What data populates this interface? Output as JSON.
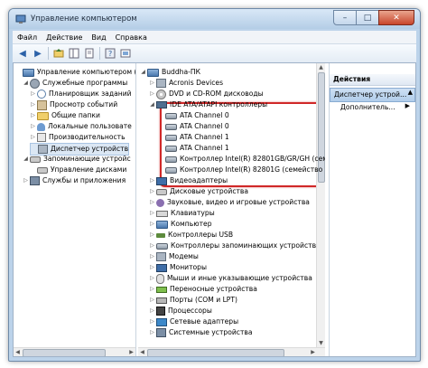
{
  "window": {
    "title": "Управление компьютером",
    "controls": {
      "minimize": "–",
      "maximize": "□",
      "close": "✕"
    }
  },
  "menu": [
    "Файл",
    "Действие",
    "Вид",
    "Справка"
  ],
  "toolbar": [
    "back-icon",
    "forward-icon",
    "up-icon",
    "show-tree-icon",
    "properties-icon",
    "help-icon",
    "view-icon"
  ],
  "left_tree": [
    {
      "label": "Управление компьютером (л",
      "level": 0,
      "expander": "",
      "icon": "pc"
    },
    {
      "label": "Служебные программы",
      "level": 1,
      "expander": "◢",
      "icon": "tool"
    },
    {
      "label": "Планировщик заданий",
      "level": 2,
      "expander": "▷",
      "icon": "clock"
    },
    {
      "label": "Просмотр событий",
      "level": 2,
      "expander": "▷",
      "icon": "log"
    },
    {
      "label": "Общие папки",
      "level": 2,
      "expander": "▷",
      "icon": "folder"
    },
    {
      "label": "Локальные пользовате",
      "level": 2,
      "expander": "▷",
      "icon": "users"
    },
    {
      "label": "Производительность",
      "level": 2,
      "expander": "▷",
      "icon": "perf"
    },
    {
      "label": "Диспетчер устройств",
      "level": 2,
      "expander": "",
      "icon": "dev",
      "selected": true
    },
    {
      "label": "Запоминающие устройс",
      "level": 1,
      "expander": "◢",
      "icon": "disk"
    },
    {
      "label": "Управление дисками",
      "level": 2,
      "expander": "",
      "icon": "disk"
    },
    {
      "label": "Службы и приложения",
      "level": 1,
      "expander": "▷",
      "icon": "sys"
    }
  ],
  "device_tree": [
    {
      "label": "Buddha-ПК",
      "level": 0,
      "expander": "◢",
      "icon": "pc"
    },
    {
      "label": "Acronis Devices",
      "level": 1,
      "expander": "▷",
      "icon": "dev"
    },
    {
      "label": "DVD и CD-ROM дисководы",
      "level": 1,
      "expander": "▷",
      "icon": "dvd"
    },
    {
      "label": "IDE ATA/ATAPI контроллеры",
      "level": 1,
      "expander": "◢",
      "icon": "chip"
    },
    {
      "label": "ATA Channel 0",
      "level": 2,
      "expander": "",
      "icon": "ctrl"
    },
    {
      "label": "ATA Channel 0",
      "level": 2,
      "expander": "",
      "icon": "ctrl"
    },
    {
      "label": "ATA Channel 1",
      "level": 2,
      "expander": "",
      "icon": "ctrl"
    },
    {
      "label": "ATA Channel 1",
      "level": 2,
      "expander": "",
      "icon": "ctrl"
    },
    {
      "label": "Контроллер Intel(R) 82801GB/GR/GH (сем",
      "level": 2,
      "expander": "",
      "icon": "ctrl"
    },
    {
      "label": "Контроллер Intel(R) 82801G (семейство",
      "level": 2,
      "expander": "",
      "icon": "ctrl"
    },
    {
      "label": "Видеоадаптеры",
      "level": 1,
      "expander": "▷",
      "icon": "monitor"
    },
    {
      "label": "Дисковые устройства",
      "level": 1,
      "expander": "▷",
      "icon": "disk"
    },
    {
      "label": "Звуковые, видео и игровые устройства",
      "level": 1,
      "expander": "▷",
      "icon": "sound"
    },
    {
      "label": "Клавиатуры",
      "level": 1,
      "expander": "▷",
      "icon": "kbd"
    },
    {
      "label": "Компьютер",
      "level": 1,
      "expander": "▷",
      "icon": "pc"
    },
    {
      "label": "Контроллеры USB",
      "level": 1,
      "expander": "▷",
      "icon": "usb"
    },
    {
      "label": "Контроллеры запоминающих устройств",
      "level": 1,
      "expander": "▷",
      "icon": "ctrl"
    },
    {
      "label": "Модемы",
      "level": 1,
      "expander": "▷",
      "icon": "dev"
    },
    {
      "label": "Мониторы",
      "level": 1,
      "expander": "▷",
      "icon": "monitor"
    },
    {
      "label": "Мыши и иные указывающие устройства",
      "level": 1,
      "expander": "▷",
      "icon": "mouse"
    },
    {
      "label": "Переносные устройства",
      "level": 1,
      "expander": "▷",
      "icon": "batt"
    },
    {
      "label": "Порты (COM и LPT)",
      "level": 1,
      "expander": "▷",
      "icon": "port"
    },
    {
      "label": "Процессоры",
      "level": 1,
      "expander": "▷",
      "icon": "cpu"
    },
    {
      "label": "Сетевые адаптеры",
      "level": 1,
      "expander": "▷",
      "icon": "net"
    },
    {
      "label": "Системные устройства",
      "level": 1,
      "expander": "▷",
      "icon": "sys"
    }
  ],
  "actions": {
    "header": "Действия",
    "section": "Диспетчер устрой...",
    "more": "Дополнитель..."
  },
  "highlight_color": "#d02828"
}
